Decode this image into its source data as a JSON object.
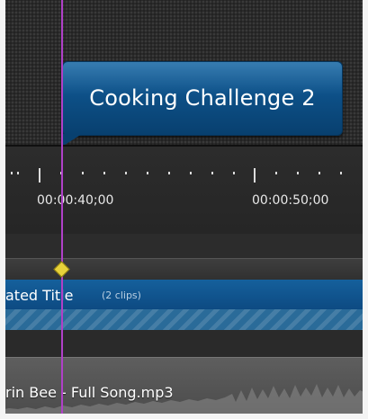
{
  "canvas": {
    "callout": {
      "text": "Cooking Challenge 2"
    }
  },
  "timeline": {
    "ruler": {
      "labels": [
        "00:00:40;00",
        "00:00:50;00"
      ]
    },
    "playhead": {
      "color": "#b040c8",
      "marker_color": "#e7d23a"
    },
    "tracks": {
      "title_clip": {
        "name": "ated Title",
        "count": "(2 clips)",
        "color": "#0d4a82"
      },
      "audio_clip": {
        "name": "rin Bee - Full Song.mp3"
      }
    }
  }
}
